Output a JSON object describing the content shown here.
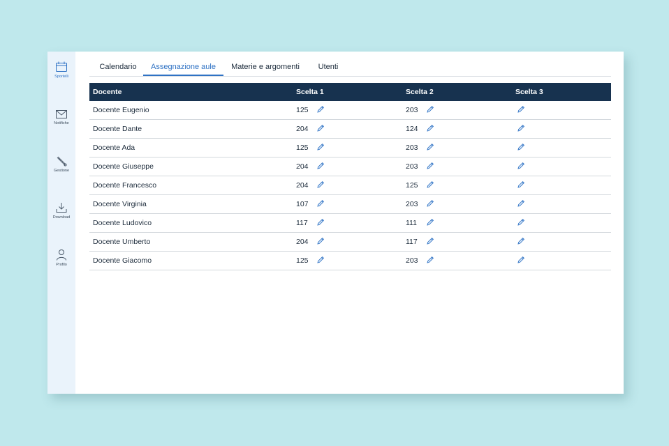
{
  "sidebar": {
    "items": [
      {
        "label": "Sportelli",
        "icon": "calendar-icon",
        "active": true
      },
      {
        "label": "Notifiche",
        "icon": "mail-icon",
        "active": false
      },
      {
        "label": "Gestione",
        "icon": "wrench-icon",
        "active": false
      },
      {
        "label": "Download",
        "icon": "download-icon",
        "active": false
      },
      {
        "label": "Profilo",
        "icon": "user-icon",
        "active": false
      }
    ]
  },
  "tabs": [
    {
      "label": "Calendario",
      "active": false
    },
    {
      "label": "Assegnazione aule",
      "active": true
    },
    {
      "label": "Materie e argomenti",
      "active": false
    },
    {
      "label": "Utenti",
      "active": false
    }
  ],
  "table": {
    "headers": [
      "Docente",
      "Scelta 1",
      "Scelta 2",
      "Scelta 3"
    ],
    "rows": [
      {
        "docente": "Docente Eugenio",
        "scelta1": "125",
        "scelta2": "203",
        "scelta3": ""
      },
      {
        "docente": "Docente Dante",
        "scelta1": "204",
        "scelta2": "124",
        "scelta3": ""
      },
      {
        "docente": "Docente Ada",
        "scelta1": "125",
        "scelta2": "203",
        "scelta3": ""
      },
      {
        "docente": "Docente Giuseppe",
        "scelta1": "204",
        "scelta2": "203",
        "scelta3": ""
      },
      {
        "docente": "Docente Francesco",
        "scelta1": "204",
        "scelta2": "125",
        "scelta3": ""
      },
      {
        "docente": "Docente Virginia",
        "scelta1": "107",
        "scelta2": "203",
        "scelta3": ""
      },
      {
        "docente": "Docente Ludovico",
        "scelta1": "117",
        "scelta2": "111",
        "scelta3": ""
      },
      {
        "docente": "Docente Umberto",
        "scelta1": "204",
        "scelta2": "117",
        "scelta3": ""
      },
      {
        "docente": "Docente Giacomo",
        "scelta1": "125",
        "scelta2": "203",
        "scelta3": ""
      }
    ]
  },
  "colors": {
    "accent": "#2f72c4",
    "header_bg": "#17324f",
    "sidebar_bg": "#eaf3fb",
    "page_bg": "#bfe8ec"
  }
}
